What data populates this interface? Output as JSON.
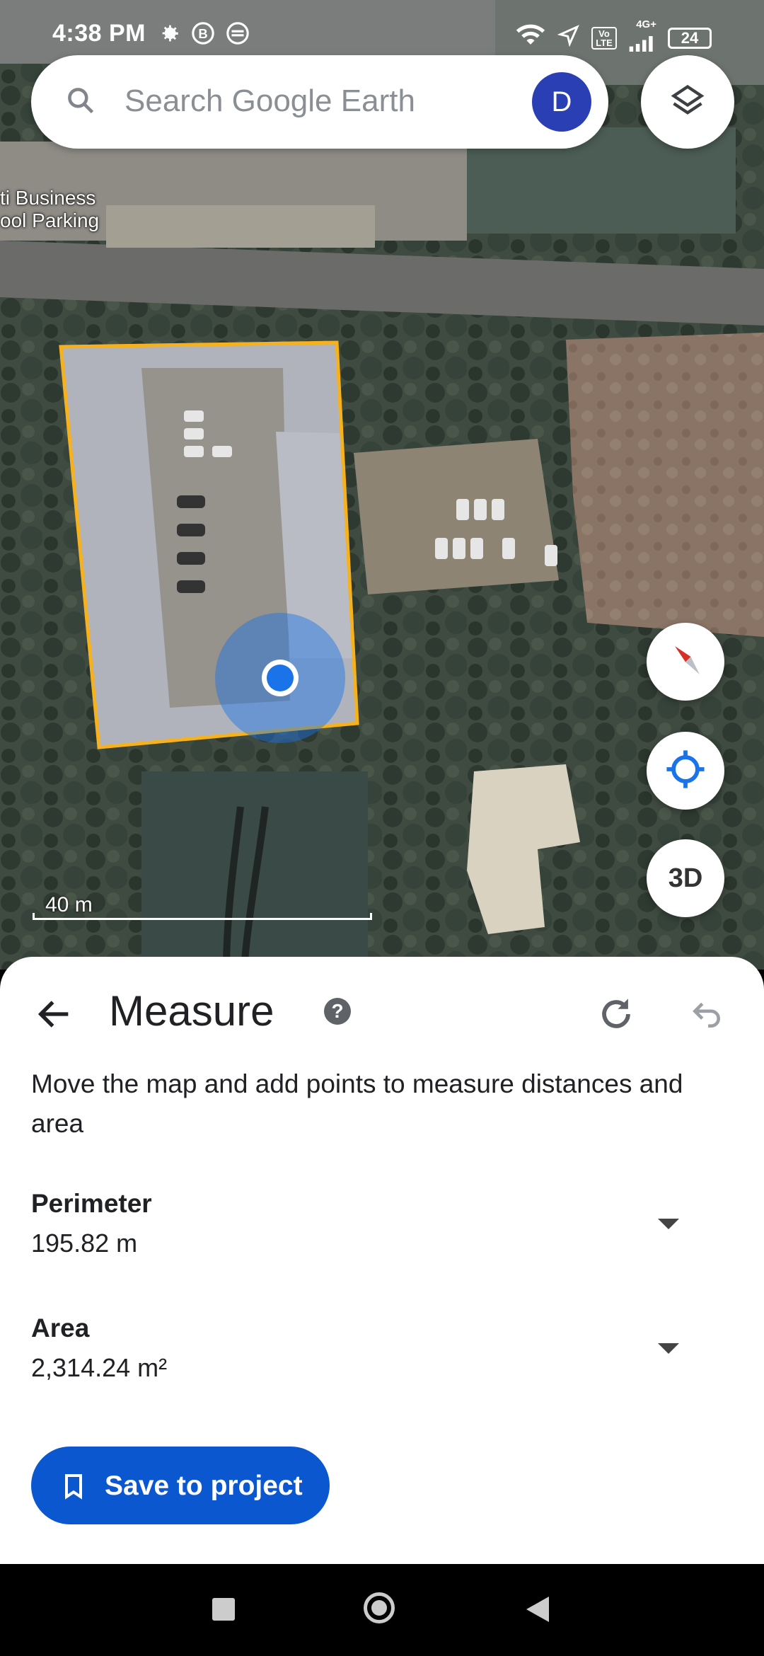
{
  "status_bar": {
    "time": "4:38 PM",
    "network_label": "4G+",
    "volte_label": "Vo LTE",
    "battery": "24"
  },
  "search": {
    "placeholder": "Search Google Earth",
    "avatar_letter": "D"
  },
  "map": {
    "place_label_line1": "ti Business",
    "place_label_line2": "ool Parking",
    "scale_label": "40 m",
    "button_3d": "3D",
    "measure_outline_color": "#f5b21e",
    "location_dot_color": "#1a73e8"
  },
  "measure_panel": {
    "title": "Measure",
    "help_icon": "?",
    "instructions": "Move the map and add points to measure distances and area",
    "perimeter_label": "Perimeter",
    "perimeter_value": "195.82 m",
    "area_label": "Area",
    "area_value": "2,314.24 m²",
    "save_button": "Save to project",
    "accent_color": "#0b57d0"
  },
  "icons": [
    "search-icon",
    "layers-icon",
    "compass-icon",
    "my-location-icon",
    "back-arrow-icon",
    "help-icon",
    "redo-icon",
    "undo-icon",
    "bookmark-icon",
    "settings-icon",
    "wifi-icon",
    "signal-icon",
    "battery-icon"
  ]
}
